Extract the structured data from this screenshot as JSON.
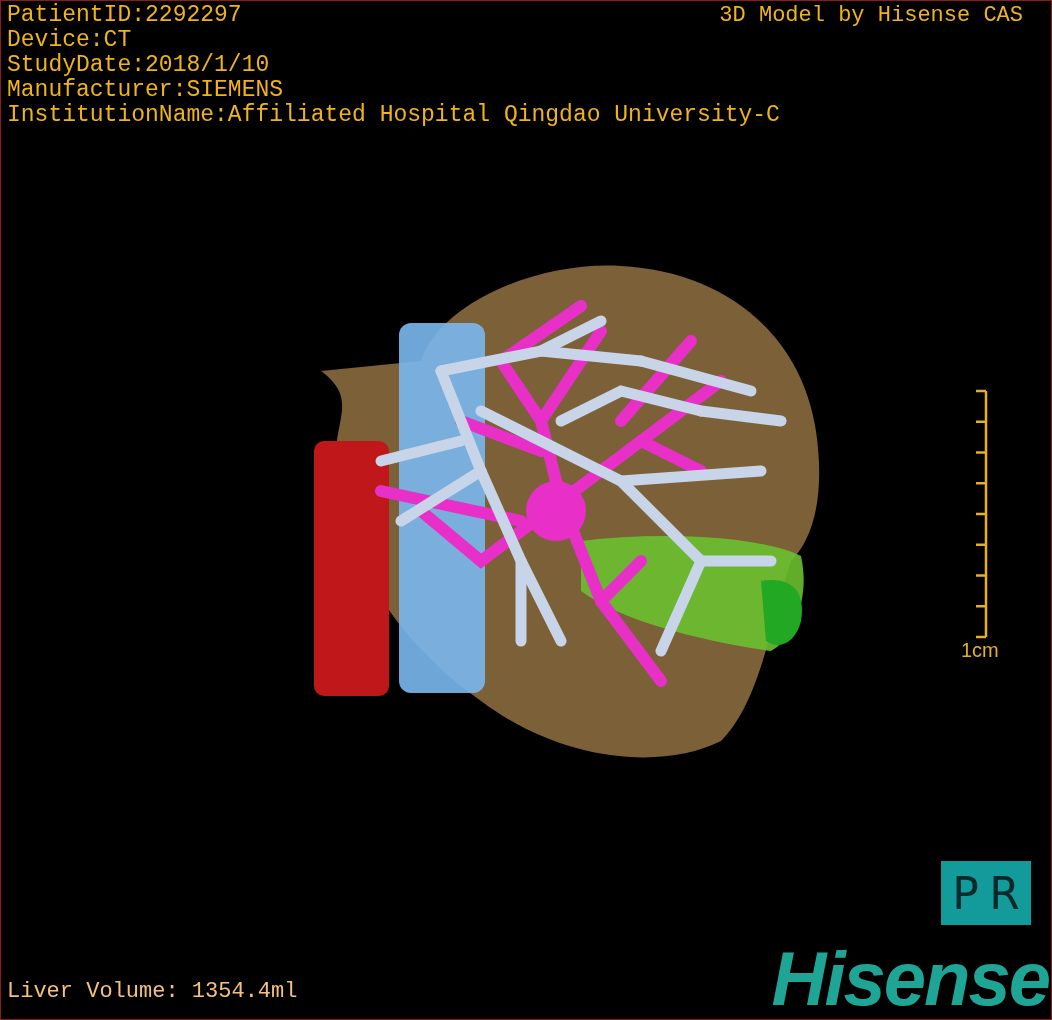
{
  "info_lines": [
    "PatientID:2292297",
    "Device:CT",
    "StudyDate:2018/1/10",
    "Manufacturer:SIEMENS",
    "InstitutionName:Affiliated Hospital Qingdao University-C"
  ],
  "model_credit": "3D Model by Hisense CAS",
  "scale": {
    "label": "1cm"
  },
  "volume": "Liver Volume: 1354.4ml",
  "orientation": [
    "P",
    "R"
  ],
  "logo": "Hisense"
}
